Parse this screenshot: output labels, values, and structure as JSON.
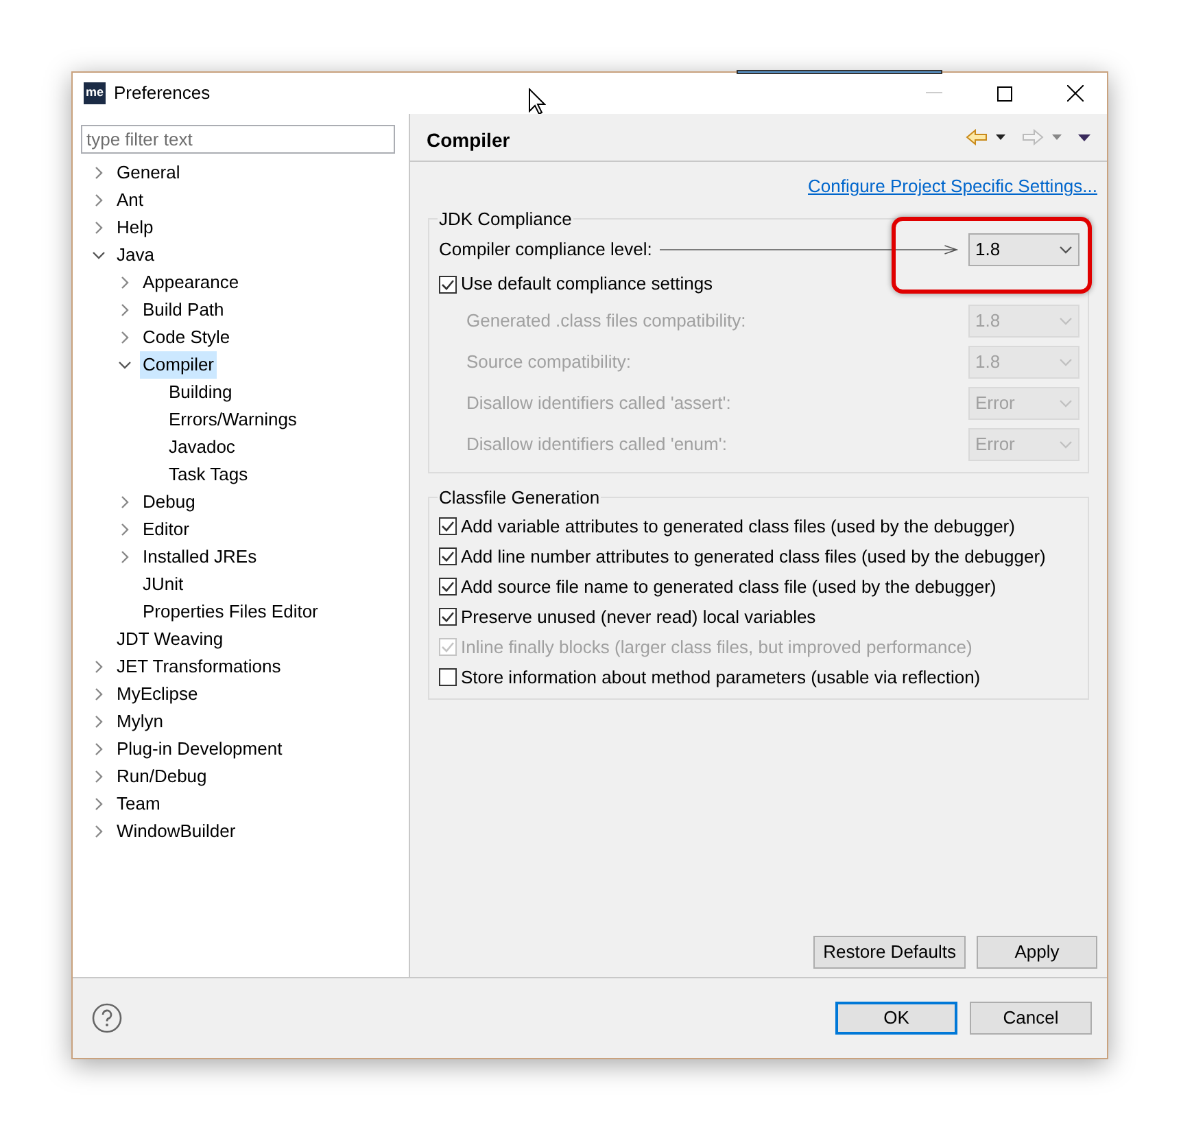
{
  "window": {
    "logo": "me",
    "title": "Preferences"
  },
  "filter": {
    "placeholder": "type filter text"
  },
  "tree": [
    {
      "label": "General",
      "expanded": false,
      "selected": false
    },
    {
      "label": "Ant",
      "expanded": false,
      "selected": false
    },
    {
      "label": "Help",
      "expanded": false,
      "selected": false
    },
    {
      "label": "Java",
      "expanded": true,
      "selected": false,
      "children": [
        {
          "label": "Appearance",
          "expanded": false,
          "selected": false
        },
        {
          "label": "Build Path",
          "expanded": false,
          "selected": false
        },
        {
          "label": "Code Style",
          "expanded": false,
          "selected": false
        },
        {
          "label": "Compiler",
          "expanded": true,
          "selected": true,
          "children": [
            {
              "label": "Building",
              "selected": false
            },
            {
              "label": "Errors/Warnings",
              "selected": false
            },
            {
              "label": "Javadoc",
              "selected": false
            },
            {
              "label": "Task Tags",
              "selected": false
            }
          ]
        },
        {
          "label": "Debug",
          "expanded": false,
          "selected": false
        },
        {
          "label": "Editor",
          "expanded": false,
          "selected": false
        },
        {
          "label": "Installed JREs",
          "expanded": false,
          "selected": false
        },
        {
          "label": "JUnit",
          "selected": false
        },
        {
          "label": "Properties Files Editor",
          "selected": false
        }
      ]
    },
    {
      "label": "JDT Weaving",
      "selected": false
    },
    {
      "label": "JET Transformations",
      "expanded": false,
      "selected": false
    },
    {
      "label": "MyEclipse",
      "expanded": false,
      "selected": false
    },
    {
      "label": "Mylyn",
      "expanded": false,
      "selected": false
    },
    {
      "label": "Plug-in Development",
      "expanded": false,
      "selected": false
    },
    {
      "label": "Run/Debug",
      "expanded": false,
      "selected": false
    },
    {
      "label": "Team",
      "expanded": false,
      "selected": false
    },
    {
      "label": "WindowBuilder",
      "expanded": false,
      "selected": false
    }
  ],
  "page": {
    "title": "Compiler",
    "link": "Configure Project Specific Settings...",
    "jdk_group": {
      "title": "JDK Compliance",
      "compliance": {
        "label": "Compiler compliance level:",
        "value": "1.8",
        "highlighted": true
      },
      "use_default": {
        "label": "Use default compliance settings",
        "checked": true
      },
      "settings": [
        {
          "label": "Generated .class files compatibility:",
          "value": "1.8",
          "disabled": true
        },
        {
          "label": "Source compatibility:",
          "value": "1.8",
          "disabled": true
        },
        {
          "label": "Disallow identifiers called 'assert':",
          "value": "Error",
          "disabled": true
        },
        {
          "label": "Disallow identifiers called 'enum':",
          "value": "Error",
          "disabled": true
        }
      ]
    },
    "classfile_group": {
      "title": "Classfile Generation",
      "options": [
        {
          "label": "Add variable attributes to generated class files (used by the debugger)",
          "checked": true,
          "disabled": false
        },
        {
          "label": "Add line number attributes to generated class files (used by the debugger)",
          "checked": true,
          "disabled": false
        },
        {
          "label": "Add source file name to generated class file (used by the debugger)",
          "checked": true,
          "disabled": false
        },
        {
          "label": "Preserve unused (never read) local variables",
          "checked": true,
          "disabled": false
        },
        {
          "label": "Inline finally blocks (larger class files, but improved performance)",
          "checked": true,
          "disabled": true
        },
        {
          "label": "Store information about method parameters (usable via reflection)",
          "checked": false,
          "disabled": false
        }
      ]
    },
    "buttons": [
      "Restore Defaults",
      "Apply"
    ]
  },
  "footer": {
    "buttons": [
      {
        "label": "OK",
        "default": true
      },
      {
        "label": "Cancel",
        "default": false
      }
    ]
  }
}
